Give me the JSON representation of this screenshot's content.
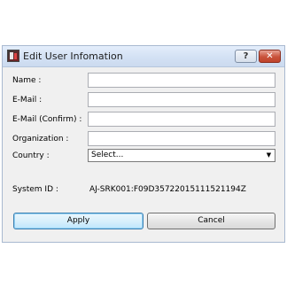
{
  "window": {
    "title": "Edit User Infomation",
    "help_label": "?",
    "close_label": "✕"
  },
  "form": {
    "name_label": "Name :",
    "name_value": "",
    "email_label": "E-Mail :",
    "email_value": "",
    "email_confirm_label": "E-Mail (Confirm) :",
    "email_confirm_value": "",
    "organization_label": "Organization :",
    "organization_value": "",
    "country_label": "Country :",
    "country_selected": "Select...",
    "country_arrow": "▼",
    "system_id_label": "System ID :",
    "system_id_value": "AJ-SRK001:F09D35722015111521194Z"
  },
  "buttons": {
    "apply_label": "Apply",
    "cancel_label": "Cancel"
  },
  "icons": {
    "app": "app-icon",
    "help": "help-icon",
    "close": "close-icon",
    "dropdown": "chevron-down-icon"
  },
  "colors": {
    "close_button": "#c9533c",
    "apply_focus_border": "#3c7fb1",
    "titlebar": "#d3e1f4"
  }
}
